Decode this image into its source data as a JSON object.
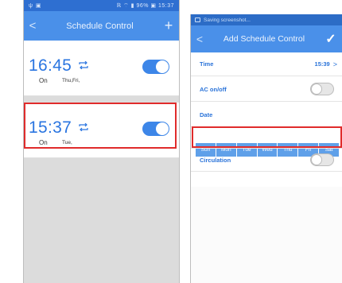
{
  "left_screen": {
    "status_bar": {
      "left": "ψ ▣",
      "right": "ℝ ⌔ ▮ 96% ▣ 15:37"
    },
    "header": {
      "back_icon": "chevron-left-icon",
      "title": "Schedule Control",
      "add_icon": "plus-icon"
    },
    "schedules": [
      {
        "time": "16:45",
        "power": "On",
        "days": "Thu,Fri,",
        "enabled": true
      },
      {
        "time": "15:37",
        "power": "On",
        "days": "Tue,",
        "enabled": true
      }
    ]
  },
  "right_screen": {
    "status_bar": {
      "text": "Saving screenshot..."
    },
    "header": {
      "back_icon": "chevron-left-icon",
      "title": "Add Schedule Control",
      "confirm_icon": "check-icon"
    },
    "rows": {
      "time": {
        "label": "Time",
        "value": "15:39"
      },
      "ac": {
        "label": "AC on/off",
        "enabled": false
      },
      "date": {
        "label": "Date"
      },
      "circulation": {
        "label": "Circulation",
        "enabled": false
      }
    },
    "days": [
      "Sun",
      "Mon",
      "Tue",
      "Wed",
      "Thu",
      "Fri",
      "Sat"
    ]
  },
  "colors": {
    "accent": "#4a90e9",
    "highlight": "#e02b2b",
    "label": "#2a73d9"
  }
}
